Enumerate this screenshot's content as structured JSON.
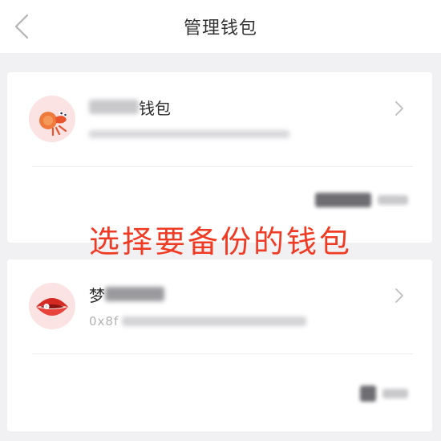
{
  "header": {
    "title": "管理钱包",
    "back_icon": "chevron-left-icon"
  },
  "wallets": [
    {
      "name_suffix": "钱包",
      "avatar_icon": "hermit-crab-icon",
      "chevron_icon": "chevron-right-icon"
    },
    {
      "name_prefix": "梦",
      "address_prefix": "0x8f",
      "avatar_icon": "clam-shell-icon",
      "chevron_icon": "chevron-right-icon"
    }
  ],
  "overlay": {
    "text": "选择要备份的钱包"
  },
  "colors": {
    "overlay_text": "#ef3a24",
    "background": "#f1f1f3",
    "card": "#ffffff"
  }
}
